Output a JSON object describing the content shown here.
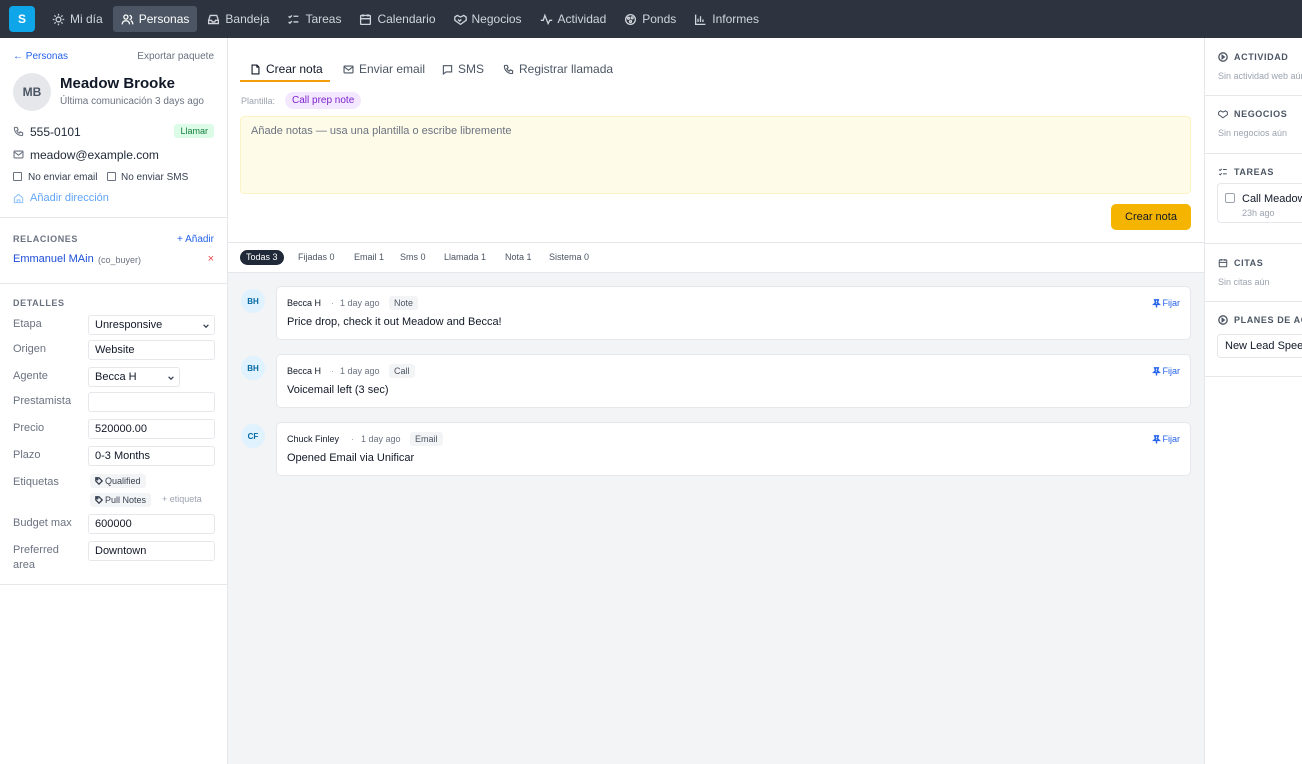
{
  "app": {
    "logo": "S"
  },
  "nav": [
    {
      "label": "Mi día",
      "icon": "sun-icon"
    },
    {
      "label": "Personas",
      "icon": "people-icon",
      "active": true
    },
    {
      "label": "Bandeja",
      "icon": "inbox-icon"
    },
    {
      "label": "Tareas",
      "icon": "tasks-icon"
    },
    {
      "label": "Calendario",
      "icon": "calendar-icon"
    },
    {
      "label": "Negocios",
      "icon": "handshake-icon"
    },
    {
      "label": "Actividad",
      "icon": "activity-icon"
    },
    {
      "label": "Ponds",
      "icon": "pond-icon"
    },
    {
      "label": "Informes",
      "icon": "chart-icon"
    }
  ],
  "person": {
    "back": "← Personas",
    "export": "Exportar paquete",
    "initials": "MB",
    "name": "Meadow Brooke",
    "last_comm": "Última comunicación 3 days ago",
    "phone": "555-0101",
    "call_label": "Llamar",
    "email": "meadow@example.com",
    "no_email": "No enviar email",
    "no_sms": "No enviar SMS",
    "add_address": "Añadir dirección"
  },
  "relations": {
    "title": "RELACIONES",
    "add": "+ Añadir",
    "items": [
      {
        "name": "Emmanuel MAin",
        "role": "(co_buyer)",
        "remove": "×"
      }
    ]
  },
  "details": {
    "title": "DETALLES",
    "fields": [
      {
        "label": "Etapa",
        "value": "Unresponsive"
      },
      {
        "label": "Origen",
        "value": "Website"
      },
      {
        "label": "Agente",
        "value": "Becca H"
      },
      {
        "label": "Prestamista",
        "value": ""
      },
      {
        "label": "Precio",
        "value": "520000.00"
      },
      {
        "label": "Plazo",
        "value": "0-3 Months"
      },
      {
        "label": "Etiquetas",
        "value": ""
      },
      {
        "label": "Budget max",
        "value": "600000"
      },
      {
        "label": "Preferred area",
        "value": "Downtown"
      }
    ],
    "tags": [
      "Qualified",
      "Pull Notes"
    ],
    "add_tag": "+ etiqueta"
  },
  "composer": {
    "tabs": [
      "Crear nota",
      "Enviar email",
      "SMS",
      "Registrar llamada"
    ],
    "template_label": "Plantilla:",
    "template_value": "Call prep note",
    "placeholder": "Añade notas — usa una plantilla o escribe libremente",
    "submit": "Crear nota"
  },
  "filters": [
    "Todas 3",
    "Fijadas 0",
    "Email 1",
    "Sms 0",
    "Llamada 1",
    "Nota 1",
    "Sistema 0"
  ],
  "timeline": [
    {
      "initials": "BH",
      "author": "Becca H",
      "time": "1 day ago",
      "type": "Note",
      "pin": "Fijar",
      "body": "Price drop, check it out Meadow and Becca!"
    },
    {
      "initials": "BH",
      "author": "Becca H",
      "time": "1 day ago",
      "type": "Call",
      "pin": "Fijar",
      "body": "Voicemail left (3 sec)"
    },
    {
      "initials": "CF",
      "author": "Chuck Finley",
      "time": "1 day ago",
      "type": "Email",
      "pin": "Fijar",
      "body": "Opened Email via Unificar"
    }
  ],
  "sidebar": {
    "activity_title": "ACTIVIDAD",
    "activity_empty": "Sin actividad web aún",
    "deals_title": "NEGOCIOS",
    "deals_empty": "Sin negocios aún",
    "tasks_title": "TAREAS",
    "task_title": "Call Meadow",
    "task_time": "23h ago",
    "appts_title": "CITAS",
    "appts_empty": "Sin citas aún",
    "plans_title": "PLANES DE ACCIÓN",
    "plan_item": "New Lead Speed"
  },
  "colors": {
    "nav_bg": "#2d3440",
    "accent": "#f5b400",
    "link": "#2563eb"
  }
}
